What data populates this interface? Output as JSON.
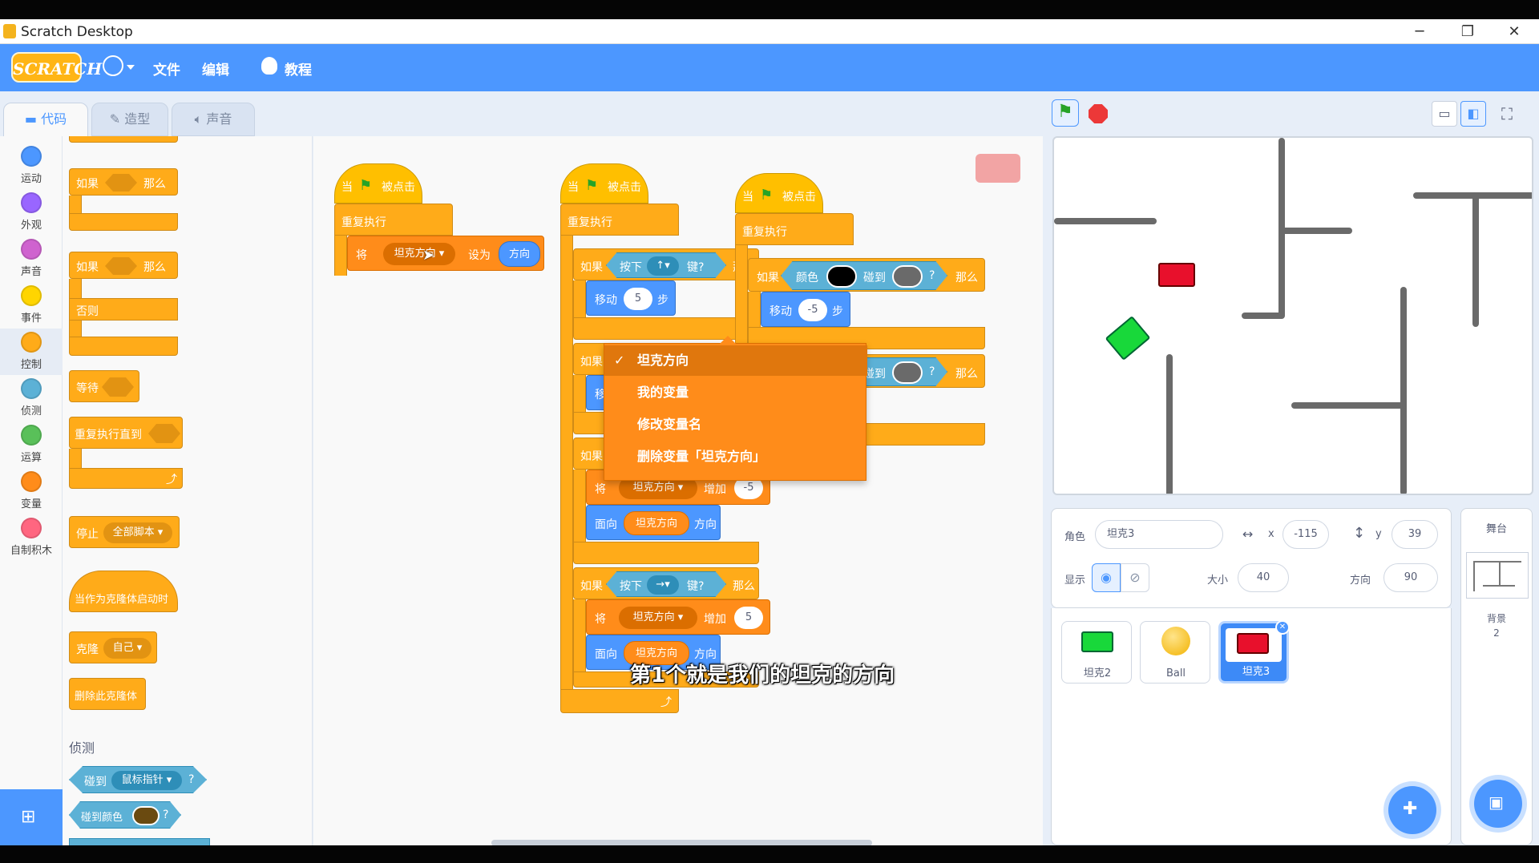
{
  "window": {
    "title": "Scratch Desktop",
    "minimize": "─",
    "restore": "❐",
    "close": "✕"
  },
  "menu": {
    "logo": "SCRATCH",
    "file": "文件",
    "edit": "编辑",
    "tutorials": "教程"
  },
  "tabs": {
    "code": "代码",
    "costumes": "造型",
    "sounds": "声音"
  },
  "categories": [
    {
      "label": "运动",
      "color": "#4c97ff"
    },
    {
      "label": "外观",
      "color": "#9966ff"
    },
    {
      "label": "声音",
      "color": "#cf63cf"
    },
    {
      "label": "事件",
      "color": "#ffd500"
    },
    {
      "label": "控制",
      "color": "#ffab19"
    },
    {
      "label": "侦测",
      "color": "#5cb1d6"
    },
    {
      "label": "运算",
      "color": "#59c059"
    },
    {
      "label": "变量",
      "color": "#ff8c1a"
    },
    {
      "label": "自制积木",
      "color": "#ff6680"
    }
  ],
  "palette": {
    "if": "如果",
    "then": "那么",
    "else": "否则",
    "wait": "等待",
    "repeat_until": "重复执行直到",
    "stop": "停止",
    "stop_option": "全部脚本",
    "when_clone": "当作为克隆体启动时",
    "clone": "克隆",
    "clone_option": "自己",
    "delete_clone": "删除此克隆体",
    "sensing_heading": "侦测",
    "touching": "碰到",
    "touching_option": "鼠标指针",
    "touching_color": "碰到颜色",
    "q": "?"
  },
  "scripts": {
    "when": "当",
    "clicked": "被点击",
    "forever": "重复执行",
    "set": "将",
    "var_name": "坦克方向",
    "set_to": "设为",
    "direction": "方向",
    "if": "如果",
    "then": "那么",
    "key_pressed": "按下",
    "key_suffix": "键?",
    "key_up": "↑",
    "key_down": "↓",
    "key_left": "←",
    "key_right": "→",
    "move": "移动",
    "steps": "步",
    "move_up": "5",
    "move_down": "-5",
    "change_by": "增加",
    "change_left": "-5",
    "change_right": "5",
    "point": "面向",
    "color": "颜色",
    "touching": "碰到",
    "q": "?",
    "move_c1": "-5",
    "move_c2": "5"
  },
  "dropdown": {
    "options": [
      "坦克方向",
      "我的变量",
      "修改变量名",
      "删除变量「坦克方向」"
    ],
    "selected_index": 0,
    "check": "✓"
  },
  "zoom": {
    "in": "+",
    "out": "−",
    "reset": "="
  },
  "subtitle": "第1个就是我们的坦克的方向",
  "sprite": {
    "label_sprite": "角色",
    "name": "坦克3",
    "label_x": "x",
    "x": "-115",
    "label_y": "y",
    "y": "39",
    "label_show": "显示",
    "label_size": "大小",
    "size": "40",
    "label_direction": "方向",
    "direction": "90"
  },
  "sprites": [
    {
      "name": "坦克2",
      "selected": false
    },
    {
      "name": "Ball",
      "selected": false
    },
    {
      "name": "坦克3",
      "selected": true
    }
  ],
  "stage_panel": {
    "title": "舞台",
    "backdrops_label": "背景",
    "backdrops_count": "2"
  }
}
